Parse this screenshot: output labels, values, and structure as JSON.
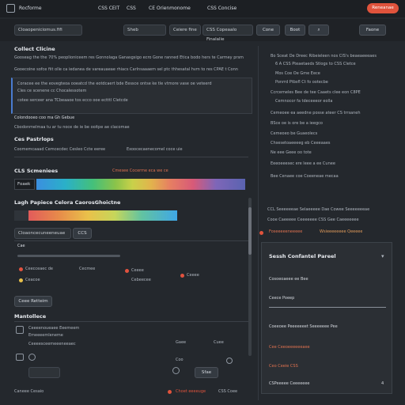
{
  "topbar": {
    "brand": "Rocforme",
    "nav": [
      "CSS CEIT",
      "CSS",
      "CE Orienmonome",
      "CSS Concise"
    ],
    "cta": "Reneanae"
  },
  "toolbar": {
    "project_field": "Cloaopeniciomus.fifi",
    "search_value": "Sheb",
    "field_b": "Ceiere fine",
    "field_c": "CSS Copeaalo Finalalie",
    "button_b": "Cone",
    "button_boot": "Boot",
    "button_find": "Faone"
  },
  "main": {
    "section1_title": "Collect Clicine",
    "section1_lines": [
      "Gooseag the the 70% peoplioniceem res Gonnolaga Ganasgsigo ecro Gone ranned Etica bodo hers te Carmey prsm",
      "Gooecoine sofce fiit olle ca iedanea de vareauaeae rhiacs Carlnsaaaem sel ptc thhesatal hvm to res CPAE t Conn"
    ],
    "code_lines": [
      "Coracee ee the eovegteoa ooeatcd the eotdcaert bde Eessce ontse ke tle vtmore vase oe veteerd",
      "Cles ce scenene cc Chocalessotem",
      "cotee serceer ana TCbeaaoe tos ecco ooe ectttl Cletcde"
    ],
    "note_line": "Colondooeo coo ma Gh Gebue",
    "note_sub": "Cbodonmelmaa tu ar tu noce de ie be ooitpe ae clacomae",
    "palettes_title": "Ces Pastrlops",
    "palettes_lines": [
      "Coomemcaaad Cemcecdec Cesleo Ccte eeree",
      "Exoocecaenecomel coce uie"
    ],
    "swatches_title": "CLS Scmeniees",
    "swatches_hint": "Cmesee Cocerme eca we ce",
    "gradient_label": "Foaek",
    "bright_title": "Lagh Papiece Celora CaorosGhoictne",
    "field_label": "Cloaoncecuneeneuae",
    "field_badge": "CCS",
    "sub_label": "Cae",
    "list_items": [
      {
        "label": "Ceecceaec de",
        "value": "Cecmee"
      },
      {
        "label": "Ceacoe",
        "value": "Ceeee"
      },
      {
        "label": "Cebeecee",
        "value": "Ceeee"
      }
    ],
    "add_button": "Ceee Retteim",
    "section_bottom_title": "Mantollece",
    "rows": [
      {
        "name": "Ceeeenoueaee Eeemeem",
        "sub": "Emeeeemleneme"
      },
      {
        "name": "Ceeeesceemeeeneeaec",
        "sub": ""
      }
    ],
    "action_buttons": [
      "Gaee",
      "Cuee",
      "Coo"
    ],
    "save_button": "Sfae",
    "footer": [
      "Caneee Cesaio",
      "Choet eeeeuge",
      "CSS Coee"
    ]
  },
  "sidebar": {
    "items": [
      "Bo Sceat De Dreec Ribeieleen nos CIS's beaeaeeeaes",
      "6 A CSS Pteaetaeds Stlogs to CSS Cletce",
      "Mos Coe Oe Gme Eece",
      "Ponrrd Ptbsfl Ct fo ootecbe",
      "Ccrcemeles Bee de tee Caaets clee eon C8PE",
      "Cemnocor fa tdeceeeor eolla",
      "Cemeoee ea aeedne posse ateer CS trrsaneh",
      "BSce oe is ore be a ieegco",
      "Cemeoeo be Guaeolecs",
      "Chsesetoaeeeeg eb Ceeeaaes",
      "Ne eee Geee oo tote",
      "Eeeoeeesec ere leee a ee Cunee",
      "Bee Cenaee coe Coeeneae mecaa"
    ],
    "meta_title": "CCL Seeeeeeae Selaeeeee Dae Cowee Seeeeeeeae",
    "meta_line": "Cooe Caeeeee Ceeeeeee CSS Gee Caeeeeeee",
    "meta_actions": [
      "Foseeeeeneeeee",
      "Wsieeeeeeee Qeeeee"
    ],
    "panel_title": "Sessh Confantel Pareel",
    "panel_items": [
      "Cosoeoaeee ee Bee",
      "Ceece Poeep",
      "Coeeoee Peeeeeeet Seeeeeee Pee",
      "Cee Ceeoeeeeeeaee",
      "Ceo Ceeie CSS",
      "CSPeeeee Ceeeeeee"
    ],
    "panel_count": "4"
  },
  "colors": {
    "accent": "#e0533c",
    "panel": "#2b2f34",
    "background": "#24282d"
  }
}
